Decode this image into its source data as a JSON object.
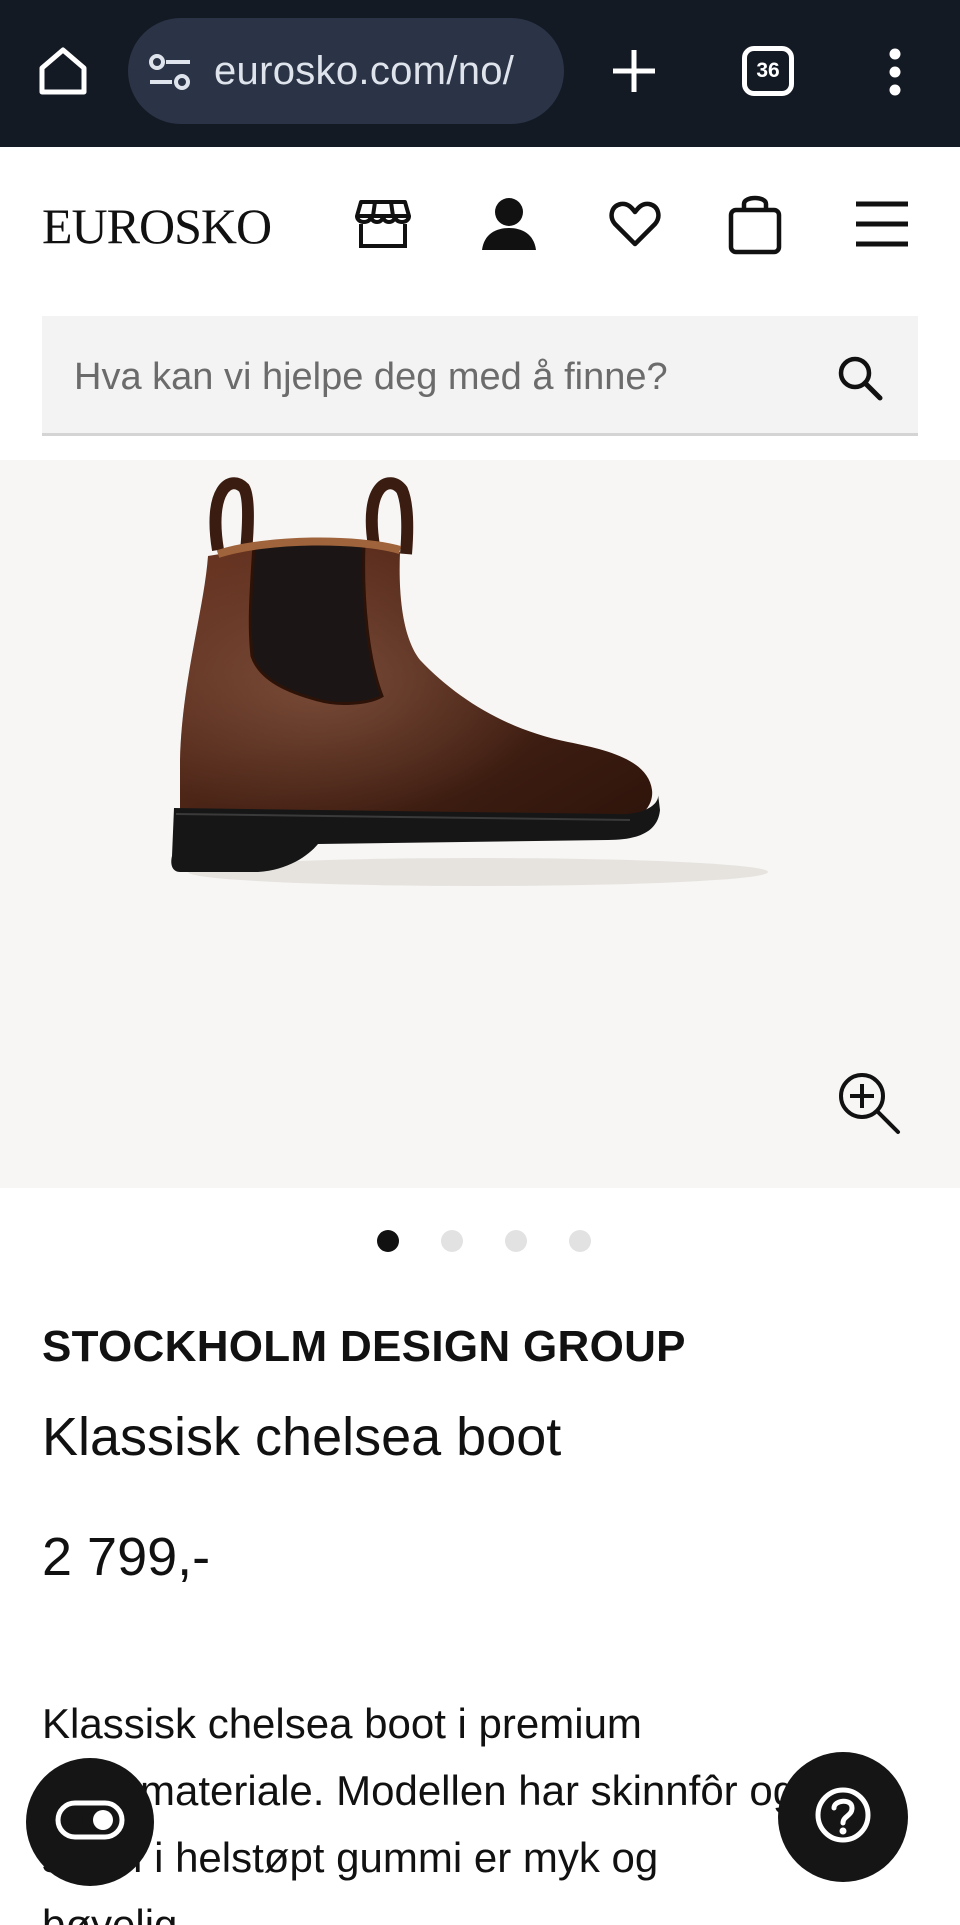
{
  "browser": {
    "url": "eurosko.com/no/",
    "tab_count": "36"
  },
  "header": {
    "logo_text": "EUROSKO"
  },
  "search": {
    "placeholder": "Hva kan vi hjelpe deg med å finne?"
  },
  "gallery": {
    "image_count": 4,
    "active_index": 0
  },
  "product": {
    "brand": "STOCKHOLM DESIGN GROUP",
    "name": "Klassisk chelsea boot",
    "price": "2 799,-",
    "description": "Klassisk chelsea boot i premium\nskinnmateriale. Modellen har skinnfôr og\nsålen i helstøpt gummi er myk og\nbøyelig."
  },
  "icons": {
    "home": "home-icon",
    "site_settings": "tune-icon",
    "new_tab": "plus-icon",
    "menu_dots": "kebab-icon",
    "store": "store-icon",
    "account": "user-icon",
    "wishlist": "heart-icon",
    "bag": "bag-icon",
    "hamburger": "menu-icon",
    "search": "search-icon",
    "zoom": "zoom-in-icon",
    "accessibility": "accessibility-toggle-icon",
    "help": "help-icon"
  },
  "colors": {
    "browser_bar": "#131a24",
    "url_pill": "#2a3446",
    "gallery_bg": "#f7f6f4",
    "fab": "#151515"
  }
}
